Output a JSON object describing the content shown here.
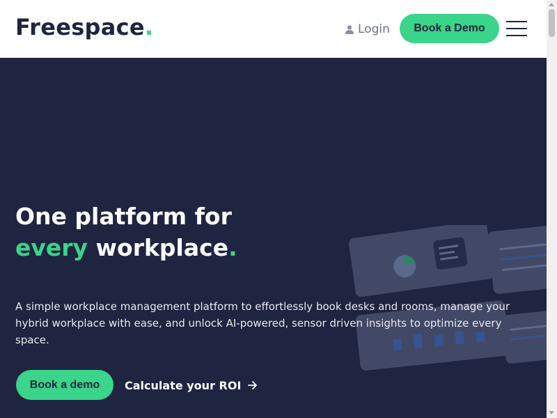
{
  "header": {
    "logo_text": "Freespace",
    "logo_dot": ".",
    "login_label": "Login",
    "demo_button_label": "Book a Demo"
  },
  "hero": {
    "headline_line1": "One platform for",
    "headline_green": "every",
    "headline_rest": " workplace",
    "headline_dot": ".",
    "description": "A simple workplace management platform to effortlessly book desks and rooms, manage your hybrid workplace with ease, and unlock AI-powered, sensor driven insights to optimize every space.",
    "cta_label": "Book a demo",
    "roi_label": "Calculate your ROI"
  },
  "colors": {
    "brand_green": "#3ad48a",
    "navy": "#1f2540",
    "header_bg": "#ffffff"
  },
  "icons": {
    "login": "user-icon",
    "roi": "arrow-right-icon",
    "menu": "hamburger-menu-icon"
  }
}
